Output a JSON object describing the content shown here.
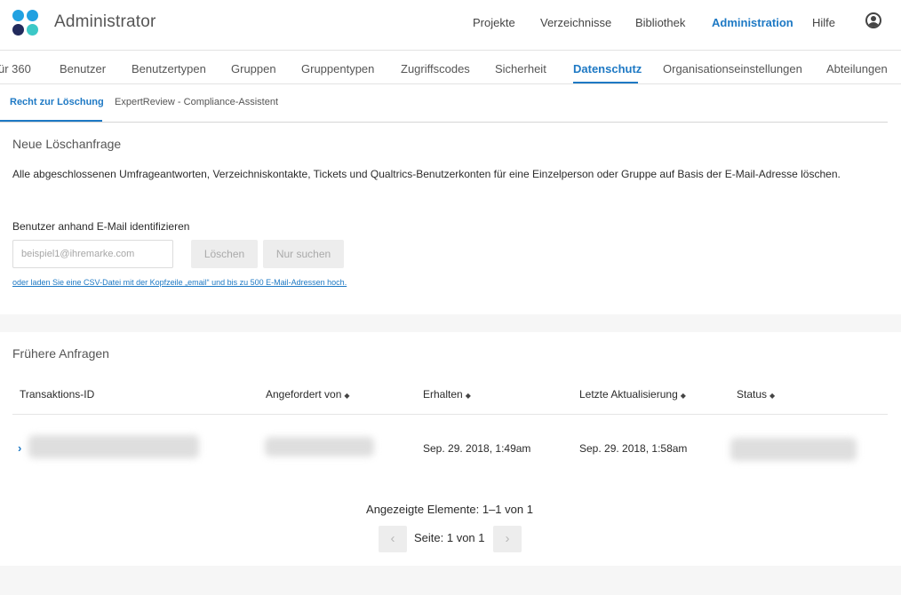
{
  "header": {
    "app_title": "Administrator",
    "nav": [
      "Projekte",
      "Verzeichnisse",
      "Bibliothek",
      "Administration",
      "Hilfe"
    ],
    "active_nav": "Administration",
    "accent_color": "#1e79c4"
  },
  "subnav": {
    "items": [
      "ür 360",
      "Benutzer",
      "Benutzertypen",
      "Gruppen",
      "Gruppentypen",
      "Zugriffscodes",
      "Sicherheit",
      "Datenschutz",
      "Organisationseinstellungen",
      "Abteilungen"
    ],
    "active": "Datenschutz"
  },
  "tabs": {
    "items": [
      "Recht zur Löschung",
      "ExpertReview - Compliance-Assistent"
    ],
    "active": "Recht zur Löschung"
  },
  "new_request": {
    "title": "Neue Löschanfrage",
    "description": "Alle abgeschlossenen Umfrageantworten, Verzeichniskontakte, Tickets und Qualtrics-Benutzerkonten für eine Einzelperson oder Gruppe auf Basis der E-Mail-Adresse löschen.",
    "field_label": "Benutzer anhand E-Mail identifizieren",
    "email_placeholder": "beispiel1@ihremarke.com",
    "delete_button": "Löschen",
    "search_button": "Nur suchen",
    "csv_link": "oder laden Sie eine CSV-Datei mit der Kopfzeile „email“ und bis zu 500 E-Mail-Adressen hoch."
  },
  "previous_requests": {
    "title": "Frühere Anfragen",
    "columns": [
      "Transaktions-ID",
      "Angefordert von",
      "Erhalten",
      "Letzte Aktualisierung",
      "Status"
    ],
    "sort_glyph": "◆",
    "rows": [
      {
        "expand_icon": "›",
        "received": "Sep. 29. 2018, 1:49am",
        "last_update": "Sep. 29. 2018, 1:58am"
      }
    ]
  },
  "pagination": {
    "info": "Angezeigte Elemente: 1–1 von 1",
    "page_text": "Seite: 1 von 1",
    "prev_icon": "‹",
    "next_icon": "›"
  }
}
